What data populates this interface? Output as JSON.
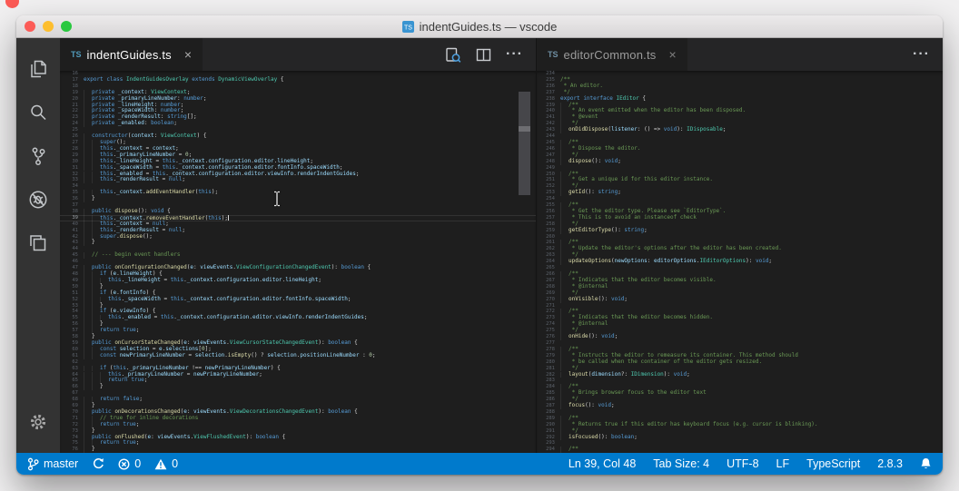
{
  "window": {
    "title": "indentGuides.ts — vscode"
  },
  "activity_bar": {
    "items": [
      "explorer",
      "search",
      "source-control",
      "debug",
      "extensions"
    ],
    "bottom": [
      "settings"
    ]
  },
  "editor_groups": [
    {
      "tab": {
        "icon_text": "TS",
        "label": "indentGuides.ts",
        "close": "×"
      },
      "actions": [
        "open-preview",
        "split-editor",
        "more-actions"
      ],
      "first_line": 16,
      "cursor_line": 39,
      "cursor_col": 48,
      "lines": [
        "",
        "export class IndentGuidesOverlay extends DynamicViewOverlay {",
        "",
        "\tprivate _context: ViewContext;",
        "\tprivate _primaryLineNumber: number;",
        "\tprivate _lineHeight: number;",
        "\tprivate _spaceWidth: number;",
        "\tprivate _renderResult: string[];",
        "\tprivate _enabled: boolean;",
        "",
        "\tconstructor(context: ViewContext) {",
        "\t\tsuper();",
        "\t\tthis._context = context;",
        "\t\tthis._primaryLineNumber = 0;",
        "\t\tthis._lineHeight = this._context.configuration.editor.lineHeight;",
        "\t\tthis._spaceWidth = this._context.configuration.editor.fontInfo.spaceWidth;",
        "\t\tthis._enabled = this._context.configuration.editor.viewInfo.renderIndentGuides;",
        "\t\tthis._renderResult = null;",
        "",
        "\t\tthis._context.addEventHandler(this);",
        "\t}",
        "",
        "\tpublic dispose(): void {",
        "\t\tthis._context.removeEventHandler(this);",
        "\t\tthis._context = null;",
        "\t\tthis._renderResult = null;",
        "\t\tsuper.dispose();",
        "\t}",
        "",
        "\t// --- begin event handlers",
        "",
        "\tpublic onConfigurationChanged(e: viewEvents.ViewConfigurationChangedEvent): boolean {",
        "\t\tif (e.lineHeight) {",
        "\t\t\tthis._lineHeight = this._context.configuration.editor.lineHeight;",
        "\t\t}",
        "\t\tif (e.fontInfo) {",
        "\t\t\tthis._spaceWidth = this._context.configuration.editor.fontInfo.spaceWidth;",
        "\t\t}",
        "\t\tif (e.viewInfo) {",
        "\t\t\tthis._enabled = this._context.configuration.editor.viewInfo.renderIndentGuides;",
        "\t\t}",
        "\t\treturn true;",
        "\t}",
        "\tpublic onCursorStateChanged(e: viewEvents.ViewCursorStateChangedEvent): boolean {",
        "\t\tconst selection = e.selections[0];",
        "\t\tconst newPrimaryLineNumber = selection.isEmpty() ? selection.positionLineNumber : 0;",
        "",
        "\t\tif (this._primaryLineNumber !== newPrimaryLineNumber) {",
        "\t\t\tthis._primaryLineNumber = newPrimaryLineNumber;",
        "\t\t\treturn true;",
        "\t\t}",
        "",
        "\t\treturn false;",
        "\t}",
        "\tpublic onDecorationsChanged(e: viewEvents.ViewDecorationsChangedEvent): boolean {",
        "\t\t// true for inline decorations",
        "\t\treturn true;",
        "\t}",
        "\tpublic onFlushed(e: viewEvents.ViewFlushedEvent): boolean {",
        "\t\treturn true;",
        "\t}"
      ]
    },
    {
      "tab": {
        "icon_text": "TS",
        "label": "editorCommon.ts",
        "close": "×"
      },
      "actions": [
        "more-actions"
      ],
      "first_line": 234,
      "lines": [
        "",
        "/**",
        " * An editor.",
        " */",
        "export interface IEditor {",
        "\t/**",
        "\t * An event emitted when the editor has been disposed.",
        "\t * @event",
        "\t */",
        "\tonDidDispose(listener: () => void): IDisposable;",
        "",
        "\t/**",
        "\t * Dispose the editor.",
        "\t */",
        "\tdispose(): void;",
        "",
        "\t/**",
        "\t * Get a unique id for this editor instance.",
        "\t */",
        "\tgetId(): string;",
        "",
        "\t/**",
        "\t * Get the editor type. Please see `EditorType`.",
        "\t * This is to avoid an instanceof check",
        "\t */",
        "\tgetEditorType(): string;",
        "",
        "\t/**",
        "\t * Update the editor's options after the editor has been created.",
        "\t */",
        "\tupdateOptions(newOptions: editorOptions.IEditorOptions): void;",
        "",
        "\t/**",
        "\t * Indicates that the editor becomes visible.",
        "\t * @internal",
        "\t */",
        "\tonVisible(): void;",
        "",
        "\t/**",
        "\t * Indicates that the editor becomes hidden.",
        "\t * @internal",
        "\t */",
        "\tonHide(): void;",
        "",
        "\t/**",
        "\t * Instructs the editor to remeasure its container. This method should",
        "\t * be called when the container of the editor gets resized.",
        "\t */",
        "\tlayout(dimension?: IDimension): void;",
        "",
        "\t/**",
        "\t * Brings browser focus to the editor text",
        "\t */",
        "\tfocus(): void;",
        "",
        "\t/**",
        "\t * Returns true if this editor has keyboard focus (e.g. cursor is blinking).",
        "\t */",
        "\tisFocused(): boolean;",
        "",
        "\t/**"
      ]
    }
  ],
  "status_bar": {
    "branch": "master",
    "errors": "0",
    "warnings": "0",
    "ln_col": "Ln 39, Col 48",
    "tab_size": "Tab Size: 4",
    "encoding": "UTF-8",
    "eol": "LF",
    "language": "TypeScript",
    "version": "2.8.3",
    "background": "#007acc"
  },
  "syntax": {
    "keywords": [
      "export",
      "class",
      "extends",
      "private",
      "public",
      "constructor",
      "super",
      "this",
      "return",
      "if",
      "const",
      "interface",
      "void",
      "boolean",
      "string",
      "number",
      "null",
      "true",
      "false",
      "new"
    ],
    "colors": {
      "keyword": "#569cd6",
      "type": "#4ec9b0",
      "function": "#dcdcaa",
      "variable": "#9cdcfe",
      "number": "#b5cea8",
      "comment": "#6a9955",
      "default": "#d4d4d4",
      "editor_background": "#1e1e1e",
      "activity_bar": "#333333",
      "tab_bar": "#252526",
      "status_bar": "#007acc"
    }
  }
}
